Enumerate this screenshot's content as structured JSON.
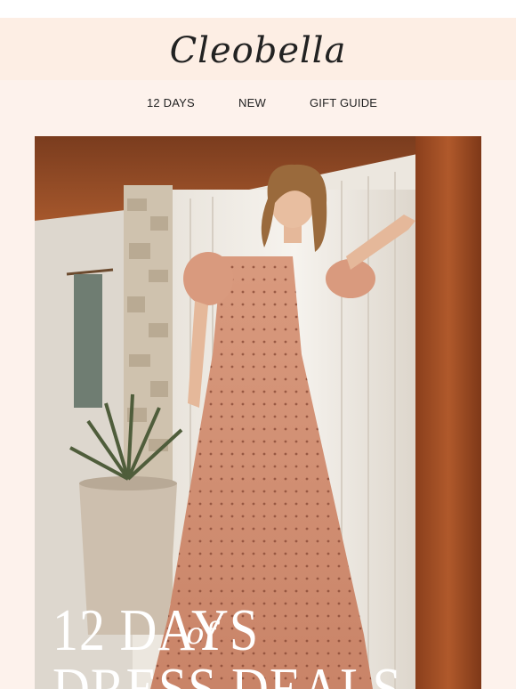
{
  "brand": {
    "logo_text": "Cleobella"
  },
  "nav": {
    "items": [
      {
        "label": "12 DAYS"
      },
      {
        "label": "NEW"
      },
      {
        "label": "GIFT GUIDE"
      }
    ]
  },
  "hero": {
    "title_line1": "12 DAYS",
    "title_of": "of",
    "title_line2": "DRESS DEALS"
  },
  "colors": {
    "page_bg": "#fdf2ec",
    "logo_band": "#fdeee4",
    "text": "#222222"
  }
}
